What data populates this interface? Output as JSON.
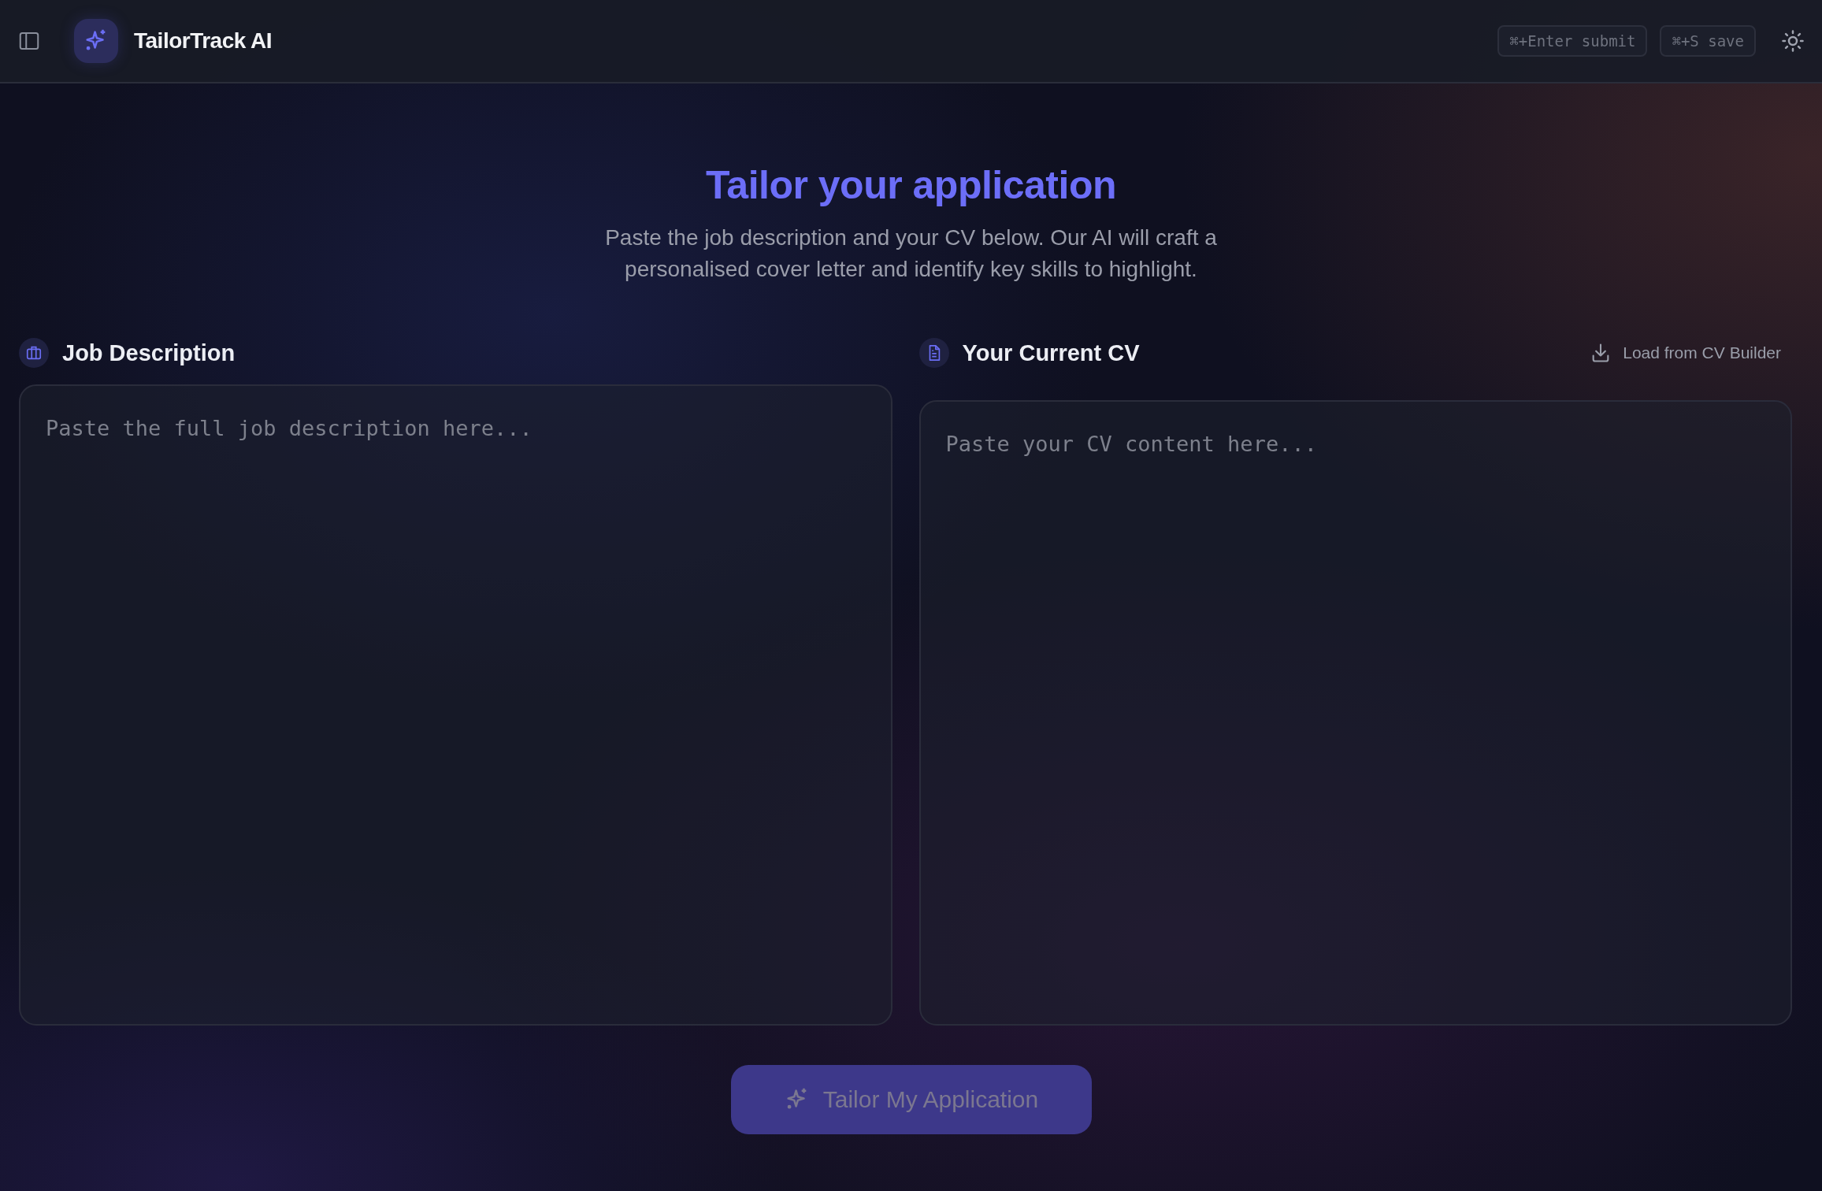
{
  "header": {
    "app_name": "TailorTrack AI",
    "shortcuts": [
      {
        "label": "⌘+Enter submit"
      },
      {
        "label": "⌘+S save"
      }
    ]
  },
  "hero": {
    "title": "Tailor your application",
    "subtitle": "Paste the job description and your CV below. Our AI will craft a personalised cover letter and identify key skills to highlight."
  },
  "panels": [
    {
      "kind": "job",
      "title": "Job Description",
      "placeholder": "Paste the full job description here..."
    },
    {
      "kind": "cv",
      "title": "Your Current CV",
      "action": "Load from CV Builder",
      "placeholder": "Paste your CV content here..."
    }
  ],
  "submit": {
    "label": "Tailor My Application",
    "disabled": true
  }
}
